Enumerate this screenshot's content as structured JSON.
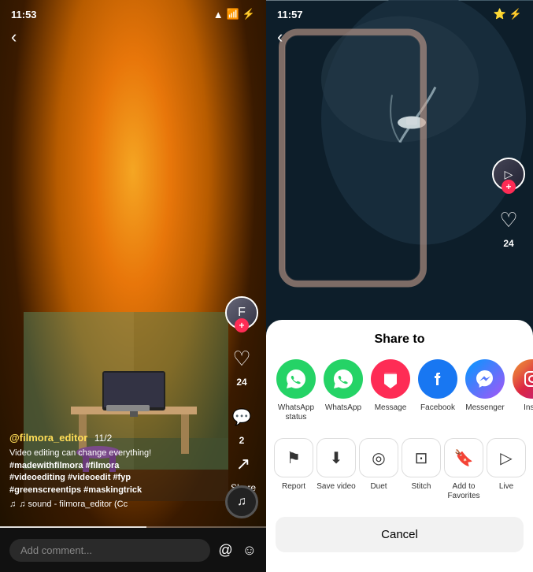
{
  "left": {
    "time": "11:53",
    "back_icon": "‹",
    "username": "@filmora_editor",
    "post_num": "11/2",
    "caption": "Video editing can change everything!\n#madewithfilmora #filmora\n#videoediting #videoedit #fyp\n#greenscreentips #maskingtrick",
    "sound": "♫ sound - filmora_editor (Cc",
    "like_count": "24",
    "comment_count": "2",
    "share_label": "Share",
    "comment_placeholder": "Add comment...",
    "avatar_plus": "+",
    "actions": {
      "like": "♡",
      "comment": "···",
      "share_arrow": "↗"
    }
  },
  "right": {
    "time": "11:57",
    "back_icon": "‹",
    "like_count": "24",
    "share_sheet": {
      "title": "Share to",
      "apps": [
        {
          "label": "WhatsApp\nstatus",
          "color": "#25D366",
          "icon": "W"
        },
        {
          "label": "WhatsApp",
          "color": "#25D366",
          "icon": "W"
        },
        {
          "label": "Message",
          "color": "#fe2c55",
          "icon": "▷"
        },
        {
          "label": "Facebook",
          "color": "#1877F2",
          "icon": "f"
        },
        {
          "label": "Messenger",
          "color": "#0084FF",
          "icon": "m"
        },
        {
          "label": "Ins...",
          "color": "#E1306C",
          "icon": "📷"
        }
      ],
      "actions": [
        {
          "label": "Report",
          "icon": "⚑"
        },
        {
          "label": "Save video",
          "icon": "⬇"
        },
        {
          "label": "Duet",
          "icon": "◎"
        },
        {
          "label": "Stitch",
          "icon": "⊡"
        },
        {
          "label": "Add to\nFavorites",
          "icon": "🔖"
        },
        {
          "label": "Live",
          "icon": "▷"
        }
      ],
      "cancel": "Cancel"
    }
  }
}
